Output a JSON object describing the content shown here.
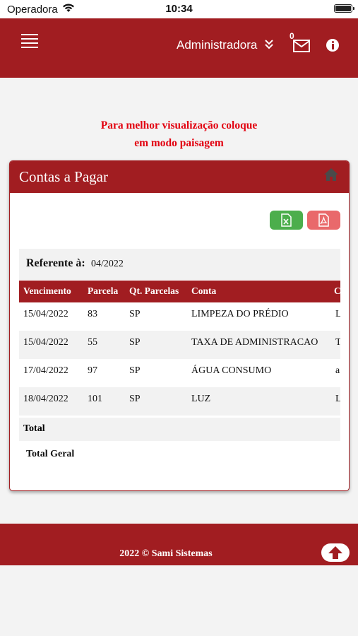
{
  "status_bar": {
    "carrier": "Operadora",
    "time": "10:34"
  },
  "navbar": {
    "user": "Administradora",
    "mail_count": "0"
  },
  "hint": {
    "line1": "Para melhor visualização coloque",
    "line2": "em modo paisagem"
  },
  "card": {
    "title": "Contas a Pagar"
  },
  "reference": {
    "label": "Referente à:",
    "value": "04/2022"
  },
  "table": {
    "headers": [
      "Vencimento",
      "Parcela",
      "Qt. Parcelas",
      "Conta",
      "C"
    ],
    "rows": [
      {
        "vencimento": "15/04/2022",
        "parcela": "83",
        "qt_parcelas": "SP",
        "conta": "LIMPEZA DO PRÉDIO",
        "extra": "L"
      },
      {
        "vencimento": "15/04/2022",
        "parcela": "55",
        "qt_parcelas": "SP",
        "conta": "TAXA DE ADMINISTRACAO",
        "extra": "T"
      },
      {
        "vencimento": "17/04/2022",
        "parcela": "97",
        "qt_parcelas": "SP",
        "conta": "ÁGUA CONSUMO",
        "extra": "a"
      },
      {
        "vencimento": "18/04/2022",
        "parcela": "101",
        "qt_parcelas": "SP",
        "conta": "LUZ",
        "extra": "L"
      }
    ],
    "total_label": "Total",
    "total_geral_label": "Total Geral"
  },
  "footer": {
    "text": "2022 © Sami Sistemas"
  },
  "colors": {
    "brand": "#a11d21",
    "hint": "#e2000f",
    "excel": "#4cae4c",
    "pdf": "#e9696b"
  },
  "icons": [
    "wifi-icon",
    "battery-icon",
    "menu-icon",
    "double-chevron-down-icon",
    "mail-icon",
    "info-icon",
    "home-icon",
    "excel-file-icon",
    "pdf-file-icon",
    "arrow-up-icon"
  ]
}
